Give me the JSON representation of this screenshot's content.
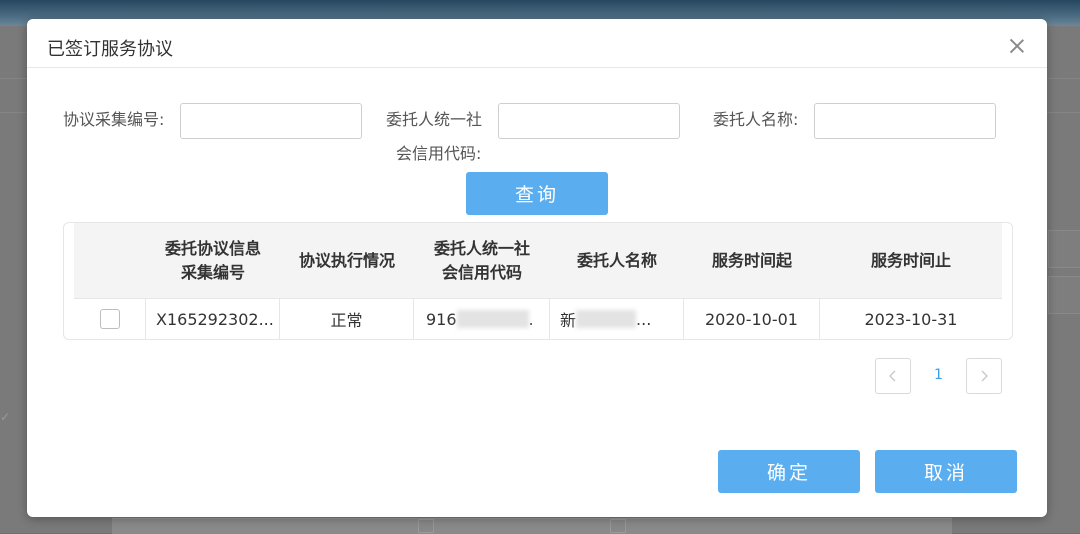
{
  "dialog": {
    "title": "已签订服务协议"
  },
  "search": {
    "code_label": "协议采集编号:",
    "code_value": "",
    "credit_label_line1": "委托人统一社",
    "credit_label_line2": "会信用代码:",
    "credit_value": "",
    "name_label": "委托人名称:",
    "name_value": "",
    "query_label": "查询"
  },
  "table": {
    "headers": {
      "code_line1": "委托协议信息",
      "code_line2": "采集编号",
      "status": "协议执行情况",
      "credit_line1": "委托人统一社",
      "credit_line2": "会信用代码",
      "name": "委托人名称",
      "start": "服务时间起",
      "end": "服务时间止"
    },
    "rows": [
      {
        "code": "X165292302...",
        "status": "正常",
        "credit_visible": "916",
        "credit_tail": ".",
        "name_visible": "新",
        "name_tail": "...",
        "start": "2020-10-01",
        "end": "2023-10-31"
      }
    ]
  },
  "pagination": {
    "current": "1",
    "prev_icon": "chevron-left-icon",
    "next_icon": "chevron-right-icon"
  },
  "footer": {
    "confirm_label": "确定",
    "cancel_label": "取消"
  },
  "colors": {
    "primary": "#5aaef0",
    "page_active": "#3a9ee8"
  }
}
